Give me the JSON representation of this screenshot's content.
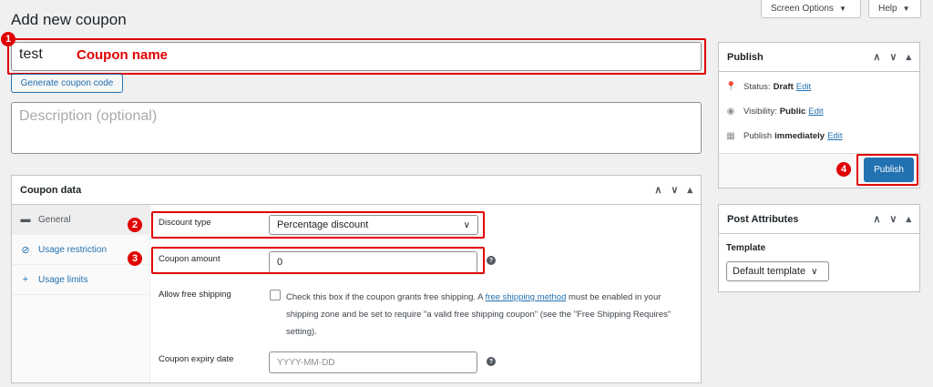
{
  "screen_options": {
    "screen_options_label": "Screen Options",
    "help_label": "Help"
  },
  "page": {
    "title": "Add new coupon"
  },
  "coupon": {
    "name_value": "test",
    "name_annotation": "Coupon name",
    "generate_label": "Generate coupon code",
    "description_placeholder": "Description (optional)"
  },
  "badges": {
    "one": "1",
    "two": "2",
    "three": "3",
    "four": "4"
  },
  "coupon_data": {
    "title": "Coupon data",
    "tabs": [
      {
        "label": "General"
      },
      {
        "label": "Usage restriction"
      },
      {
        "label": "Usage limits"
      }
    ],
    "discount_type_label": "Discount type",
    "discount_type_value": "Percentage discount",
    "amount_label": "Coupon amount",
    "amount_value": "0",
    "free_shipping_label": "Allow free shipping",
    "free_shipping_text_1": "Check this box if the coupon grants free shipping. A",
    "free_shipping_link": "free shipping method",
    "free_shipping_text_2": "must be enabled in your shipping zone and be set to require \"a valid free shipping coupon\" (see the \"Free Shipping Requires\" setting).",
    "expiry_label": "Coupon expiry date",
    "expiry_placeholder": "YYYY-MM-DD"
  },
  "publish": {
    "title": "Publish",
    "status_label": "Status:",
    "status_value": "Draft",
    "visibility_label": "Visibility:",
    "visibility_value": "Public",
    "publish_label": "Publish",
    "publish_value": "immediately",
    "edit_label": "Edit",
    "button_label": "Publish"
  },
  "post_attributes": {
    "title": "Post Attributes",
    "template_label": "Template",
    "template_value": "Default template"
  },
  "colors": {
    "annotation": "#e00000",
    "primary": "#2271b1"
  }
}
